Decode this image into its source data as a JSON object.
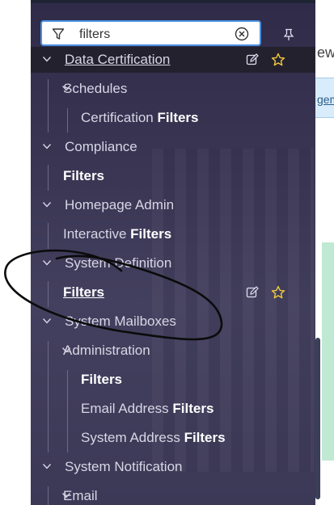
{
  "search": {
    "value": "filters",
    "placeholder": ""
  },
  "background": {
    "view_text": "ew",
    "link_text": "gem"
  },
  "tree": [
    {
      "label": "Data Certification",
      "bold": "",
      "level": 0,
      "expanded": true,
      "actions": true
    },
    {
      "label": "Schedules",
      "bold": "",
      "level": 1,
      "expanded": true
    },
    {
      "label": "Certification ",
      "bold": "Filters",
      "level": 2
    },
    {
      "label": "Compliance",
      "bold": "",
      "level": 0,
      "expanded": true
    },
    {
      "label": "",
      "bold": "Filters",
      "level": 1
    },
    {
      "label": "Homepage Admin",
      "bold": "",
      "level": 0,
      "expanded": true
    },
    {
      "label": "Interactive ",
      "bold": "Filters",
      "level": 1
    },
    {
      "label": "System Definition",
      "bold": "",
      "level": 0,
      "expanded": true
    },
    {
      "label": "",
      "bold": "Filters",
      "level": 1,
      "actions": true
    },
    {
      "label": "System Mailboxes",
      "bold": "",
      "level": 0,
      "expanded": true
    },
    {
      "label": "Administration",
      "bold": "",
      "level": 1,
      "expanded": true
    },
    {
      "label": "",
      "bold": "Filters",
      "level": 2
    },
    {
      "label": "Email Address ",
      "bold": "Filters",
      "level": 2
    },
    {
      "label": "System Address ",
      "bold": "Filters",
      "level": 2
    },
    {
      "label": "System Notification",
      "bold": "",
      "level": 0,
      "expanded": true
    },
    {
      "label": "Email",
      "bold": "",
      "level": 1,
      "expanded": true
    }
  ]
}
